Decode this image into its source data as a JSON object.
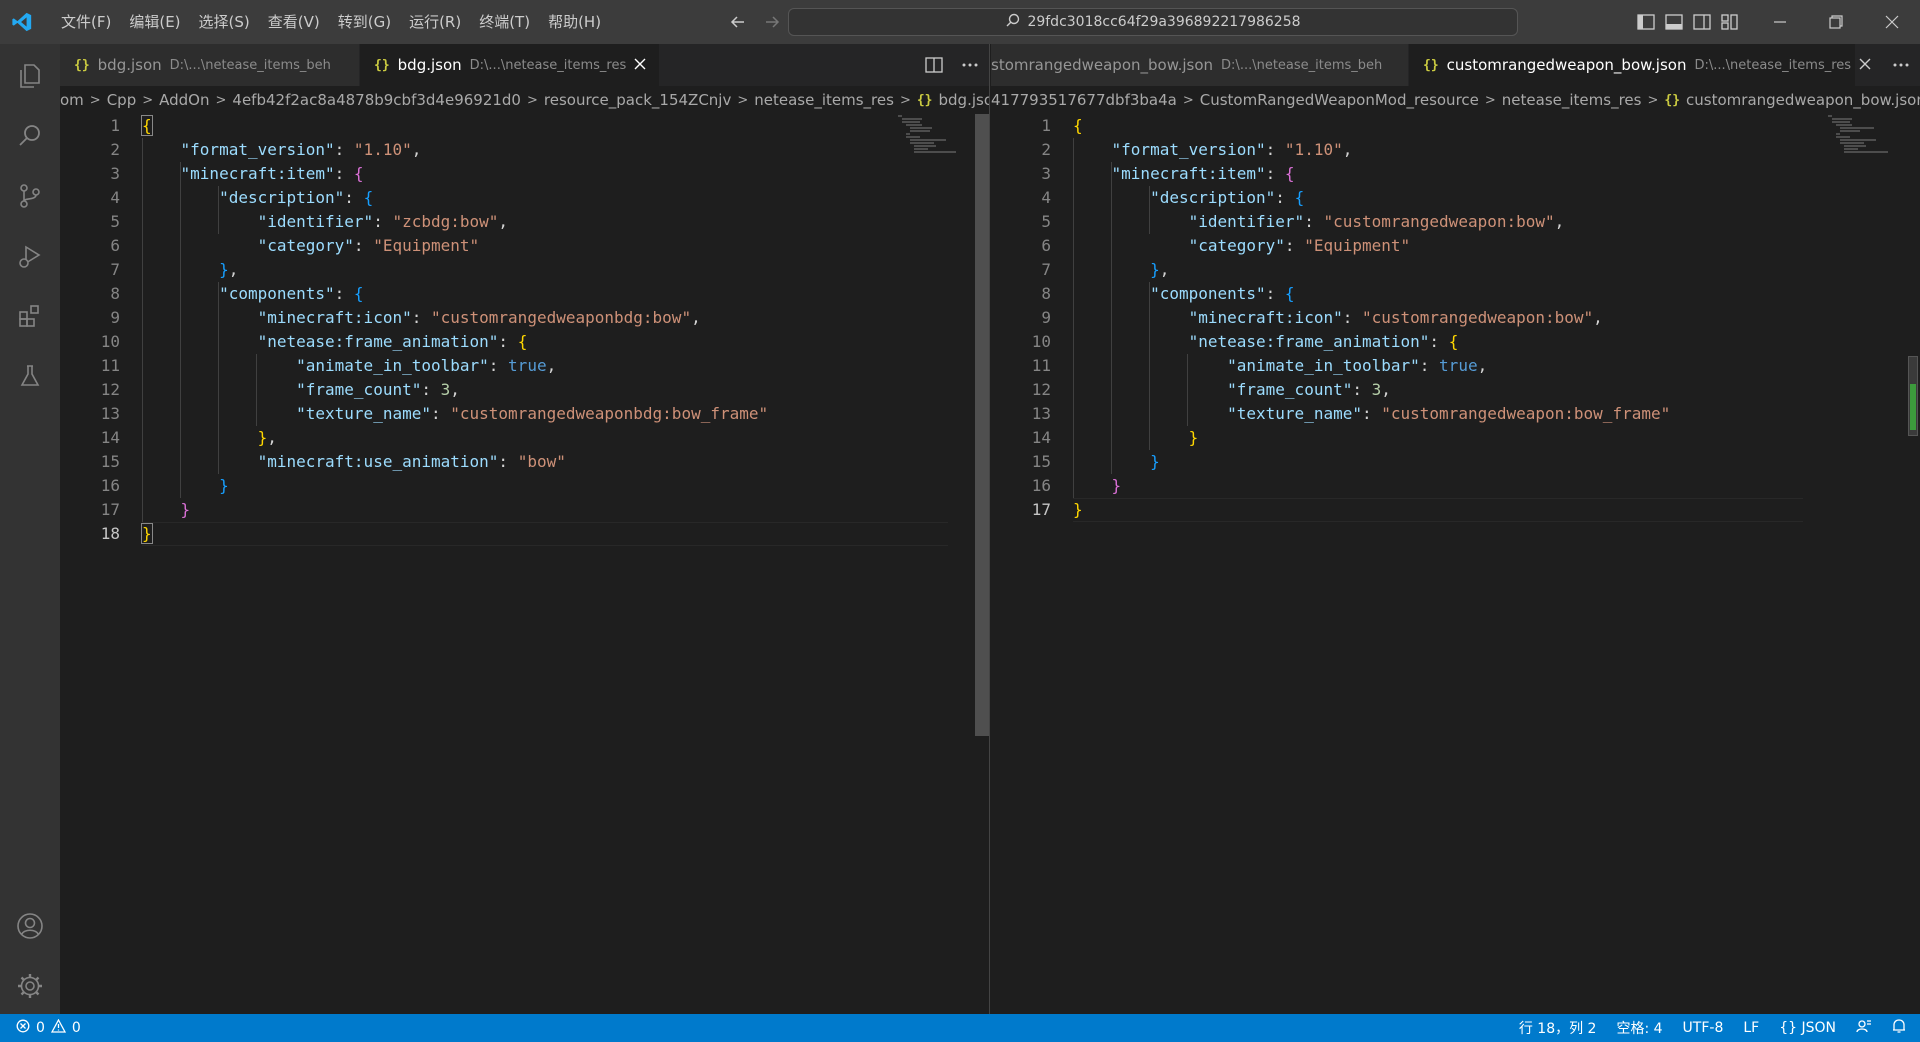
{
  "titlebar": {
    "menu": [
      "文件(F)",
      "编辑(E)",
      "选择(S)",
      "查看(V)",
      "转到(G)",
      "运行(R)",
      "终端(T)",
      "帮助(H)"
    ],
    "search_text": "29fdc3018cc64f29a396892217986258"
  },
  "left_group": {
    "tabs": [
      {
        "name": "bdg.json",
        "desc": "D:\\...\\netease_items_beh",
        "active": false
      },
      {
        "name": "bdg.json",
        "desc": "D:\\...\\netease_items_res",
        "active": true
      }
    ],
    "breadcrumb": [
      "om",
      "Cpp",
      "AddOn",
      "4efb42f2ac8a4878b9cbf3d4e96921d0",
      "resource_pack_154ZCnjv",
      "netease_items_res",
      "bdg.json",
      "..."
    ],
    "line_numbers": [
      "1",
      "2",
      "3",
      "4",
      "5",
      "6",
      "7",
      "8",
      "9",
      "10",
      "11",
      "12",
      "13",
      "14",
      "15",
      "16",
      "17",
      "18"
    ],
    "current_line": "18"
  },
  "right_group": {
    "tabs": [
      {
        "name": "stomrangedweapon_bow.json",
        "desc": "D:\\...\\netease_items_beh",
        "active": false
      },
      {
        "name": "customrangedweapon_bow.json",
        "desc": "D:\\...\\netease_items_res",
        "active": true
      }
    ],
    "breadcrumb": [
      "417793517677dbf3ba4a",
      "CustomRangedWeaponMod_resource",
      "netease_items_res",
      "customrangedweapon_bow.json",
      "..."
    ],
    "line_numbers": [
      "1",
      "2",
      "3",
      "4",
      "5",
      "6",
      "7",
      "8",
      "9",
      "10",
      "11",
      "12",
      "13",
      "14",
      "15",
      "16",
      "17"
    ],
    "current_line": "17"
  },
  "code_text": {
    "format_version_key": "\"format_version\"",
    "format_version_val": "\"1.10\"",
    "item_key": "\"minecraft:item\"",
    "description_key": "\"description\"",
    "identifier_key": "\"identifier\"",
    "category_key": "\"category\"",
    "category_val": "\"Equipment\"",
    "components_key": "\"components\"",
    "icon_key": "\"minecraft:icon\"",
    "frame_anim_key": "\"netease:frame_animation\"",
    "toolbar_key": "\"animate_in_toolbar\"",
    "true_val": "true",
    "frame_count_key": "\"frame_count\"",
    "frame_count_val": "3",
    "texture_key": "\"texture_name\"",
    "use_anim_key": "\"minecraft:use_animation\"",
    "use_anim_val": "\"bow\"",
    "left_identifier_val": "\"zcbdg:bow\"",
    "left_icon_val": "\"customrangedweaponbdg:bow\"",
    "left_texture_val": "\"customrangedweaponbdg:bow_frame\"",
    "right_identifier_val": "\"customrangedweapon:bow\"",
    "right_icon_val": "\"customrangedweapon:bow\"",
    "right_texture_val": "\"customrangedweapon:bow_frame\""
  },
  "statusbar": {
    "errors": "0",
    "warnings": "0",
    "position": "行 18，列 2",
    "spaces": "空格: 4",
    "encoding": "UTF-8",
    "eol": "LF",
    "language": "{} JSON"
  },
  "colors": {
    "statusbar": "#007acc",
    "titlebar": "#3c3c3c",
    "editor_bg": "#1e1e1e",
    "string": "#ce9178",
    "key": "#9cdcfe",
    "bracket_level1": "#ffd700",
    "bracket_level2": "#da70d6",
    "bracket_level3": "#179fff"
  }
}
